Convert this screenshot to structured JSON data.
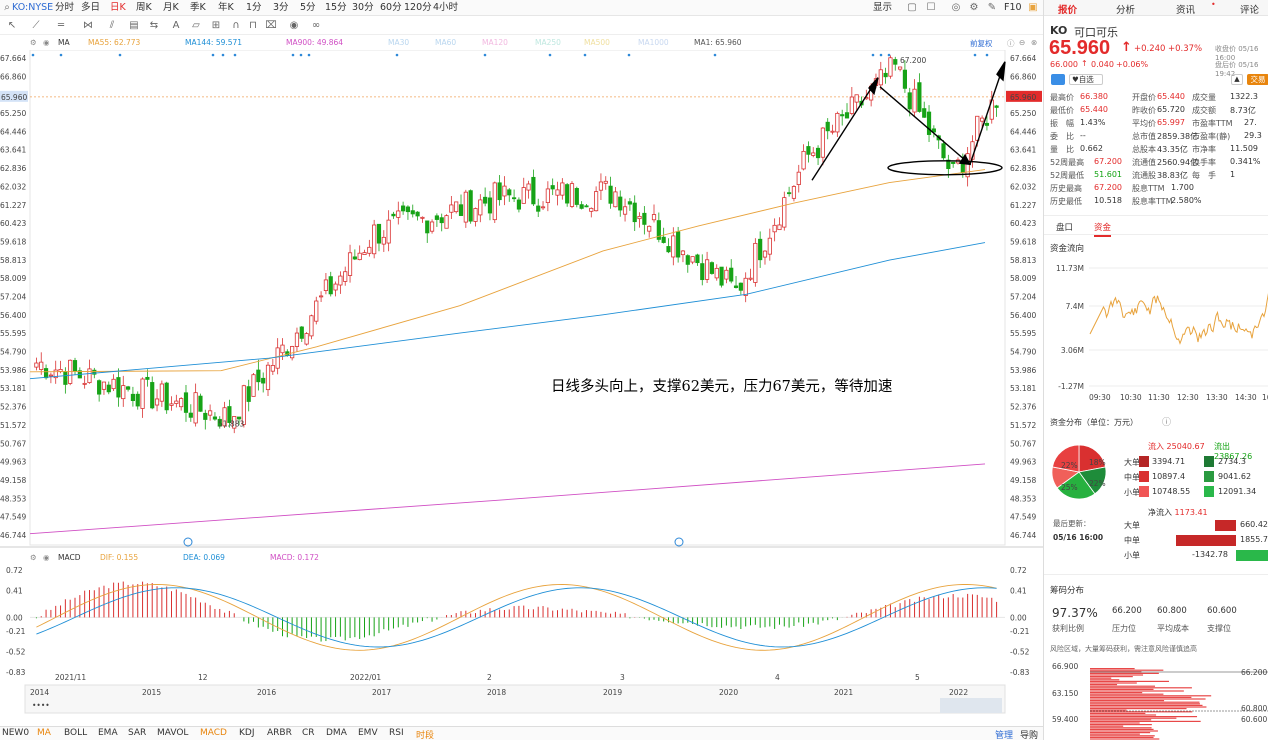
{
  "toolbar": {
    "symbol": "KO:NYSE",
    "periods": [
      "分时",
      "多日",
      "日K",
      "周K",
      "月K",
      "季K",
      "年K",
      "1分",
      "3分",
      "5分",
      "15分",
      "30分",
      "60分",
      "120分",
      "4小时"
    ],
    "active_period": "日K",
    "right_items": [
      "显示",
      "F10"
    ]
  },
  "indicators": {
    "ma_label": "MA",
    "ma55": "MA55: 62.773",
    "ma144": "MA144: 59.571",
    "ma900": "MA900: 49.864",
    "ma_extra": [
      "MA30",
      "MA60",
      "MA120",
      "MA250",
      "MA500",
      "MA1000"
    ],
    "ma1": "MA1: 65.960",
    "adjust": "前复权",
    "macd_label": "MACD",
    "dif": "DIF: 0.155",
    "dea": "DEA: 0.069",
    "macd": "MACD: 0.172"
  },
  "chart_data": [
    {
      "type": "candlestick",
      "title": "KO:NYSE 日K",
      "y_ticks": [
        "67.664",
        "66.860",
        "66.055",
        "65.250",
        "64.446",
        "63.641",
        "62.836",
        "62.032",
        "61.227",
        "60.423",
        "59.618",
        "58.813",
        "58.009",
        "57.204",
        "56.400",
        "55.595",
        "54.790",
        "53.986",
        "53.181",
        "52.376",
        "51.572",
        "50.767",
        "49.963",
        "49.158",
        "48.353",
        "47.549",
        "46.744"
      ],
      "current_price_label": "65.960",
      "high_label": "67.200",
      "low_label": "51.883",
      "x_labels": [
        "2021/11",
        "12",
        "2022/01",
        "2",
        "3",
        "4",
        "5"
      ],
      "ylim": [
        46.744,
        67.664
      ],
      "key_points": [
        {
          "date": "2021/11",
          "close": 54.3
        },
        {
          "date": "2021/12 low",
          "close": 51.883
        },
        {
          "date": "2022/01",
          "close": 60.0
        },
        {
          "date": "2022/02",
          "close": 61.5
        },
        {
          "date": "2022/03",
          "close": 61.8
        },
        {
          "date": "2022/03 dip",
          "close": 57.4
        },
        {
          "date": "2022/04",
          "close": 63.4
        },
        {
          "date": "2022/04 high",
          "close": 67.2
        },
        {
          "date": "2022/05",
          "close": 62.5
        },
        {
          "date": "2022/05/16",
          "close": 65.96
        }
      ],
      "series": [
        {
          "name": "MA55",
          "color": "#e8a33d",
          "points": [
            [
              0,
              53.9
            ],
            [
              0.2,
              53.95
            ],
            [
              0.3,
              55.0
            ],
            [
              0.45,
              56.8
            ],
            [
              0.6,
              59.2
            ],
            [
              0.7,
              60.3
            ],
            [
              0.8,
              61.3
            ],
            [
              0.9,
              62.2
            ],
            [
              1.0,
              62.77
            ]
          ]
        },
        {
          "name": "MA144",
          "color": "#1f8fd6",
          "points": [
            [
              0,
              53.6
            ],
            [
              0.25,
              54.5
            ],
            [
              0.45,
              55.6
            ],
            [
              0.6,
              56.4
            ],
            [
              0.75,
              57.3
            ],
            [
              0.9,
              58.8
            ],
            [
              1.0,
              59.57
            ]
          ]
        },
        {
          "name": "MA900",
          "color": "#d04fc4",
          "points": [
            [
              0,
              46.8
            ],
            [
              0.5,
              48.3
            ],
            [
              1.0,
              49.86
            ]
          ]
        }
      ]
    },
    {
      "type": "bar",
      "title": "MACD",
      "y_ticks": [
        "0.72",
        "0.41",
        "0.00",
        "-0.21",
        "-0.52",
        "-0.83"
      ],
      "ylim": [
        -0.83,
        0.72
      ]
    }
  ],
  "annotation_text": "日线多头向上，支撑62美元，压力67美元，等待加速",
  "timeline": {
    "years": [
      "2014",
      "2015",
      "2016",
      "2017",
      "2018",
      "2019",
      "2020",
      "2021",
      "2022"
    ]
  },
  "bottom_bar": {
    "items": [
      "NEW0",
      "MA",
      "BOLL",
      "EMA",
      "SAR",
      "MAVOL",
      "MACD",
      "KDJ",
      "ARBR",
      "CR",
      "DMA",
      "EMV",
      "RSI",
      "时段"
    ],
    "active": [
      "MA",
      "MACD"
    ],
    "right": [
      "管理",
      "导购"
    ]
  },
  "quote": {
    "tabs": [
      "报价",
      "分析",
      "资讯",
      "评论"
    ],
    "code": "KO",
    "name": "可口可乐",
    "price": "65.960",
    "change": "+0.240",
    "change_pct": "+0.37%",
    "close_label": "收盘价 05/16 16:00",
    "after_price": "66.000",
    "after_change": "0.040",
    "after_pct": "+0.06%",
    "after_label": "盘后价 05/16 19:42",
    "watch_btn": "自选",
    "trade_btn": "交易",
    "stats": [
      [
        "最高价",
        "66.380",
        "开盘价",
        "65.440",
        "成交量",
        "1322.3"
      ],
      [
        "最低价",
        "65.440",
        "昨收价",
        "65.720",
        "成交额",
        "8.73亿"
      ],
      [
        "振　幅",
        "1.43%",
        "平均价",
        "65.997",
        "市盈率TTM",
        "27."
      ],
      [
        "委　比",
        "--",
        "总市值",
        "2859.38亿",
        "市盈率(静)",
        "29.3"
      ],
      [
        "量　比",
        "0.662",
        "总股本",
        "43.35亿",
        "市净率",
        "11.509"
      ],
      [
        "52周最高",
        "67.200",
        "流通值",
        "2560.94亿",
        "换手率",
        "0.341%"
      ],
      [
        "52周最低",
        "51.601",
        "流通股",
        "38.83亿",
        "每　手",
        "1"
      ],
      [
        "历史最高",
        "67.200",
        "股息TTM",
        "1.700",
        "",
        ""
      ],
      [
        "历史最低",
        "10.518",
        "股息率TTM",
        "2.580%",
        "",
        ""
      ]
    ],
    "subtabs": [
      "盘口",
      "资金"
    ],
    "flow_title": "资金流向",
    "flow_y": [
      "11.73M",
      "7.4M",
      "3.06M",
      "-1.27M"
    ],
    "flow_x": [
      "09:30",
      "10:30",
      "11:30",
      "12:30",
      "13:30",
      "14:30",
      "16"
    ],
    "dist_title": "资金分布（单位：万元）",
    "pie": [
      "22%",
      "18%",
      "22%",
      "25%"
    ],
    "flow_in_label": "流入",
    "flow_in": "25040.67",
    "flow_out_label": "流出",
    "flow_out": "23867.26",
    "dist_rows": [
      [
        "大单",
        "3394.71",
        "2734.3"
      ],
      [
        "中单",
        "10897.4",
        "9041.62"
      ],
      [
        "小单",
        "10748.55",
        "12091.34"
      ]
    ],
    "net_label": "净流入",
    "net": "1173.41",
    "update_label": "最后更新：",
    "update_time": "05/16 16:00",
    "net_rows": [
      [
        "大单",
        "660.42"
      ],
      [
        "中单",
        "1855.78"
      ],
      [
        "小单",
        "-1342.78"
      ]
    ],
    "chip_title": "筹码分布",
    "chip_stats": [
      [
        "97.37%",
        "获利比例"
      ],
      [
        "66.200",
        "压力位"
      ],
      [
        "60.800",
        "平均成本"
      ],
      [
        "60.600",
        "支撑位"
      ]
    ],
    "chip_note": "风险区域，大量筹码获利，需注意风险谨慎追高",
    "chip_y": [
      "66.900",
      "63.150",
      "59.400"
    ],
    "chip_r": [
      "66.200",
      "60.800",
      "60.600"
    ]
  }
}
